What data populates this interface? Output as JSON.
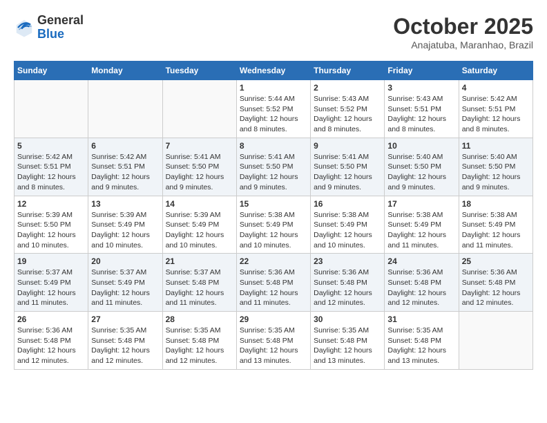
{
  "header": {
    "logo_line1": "General",
    "logo_line2": "Blue",
    "month": "October 2025",
    "location": "Anajatuba, Maranhao, Brazil"
  },
  "weekdays": [
    "Sunday",
    "Monday",
    "Tuesday",
    "Wednesday",
    "Thursday",
    "Friday",
    "Saturday"
  ],
  "weeks": [
    [
      {
        "day": "",
        "info": ""
      },
      {
        "day": "",
        "info": ""
      },
      {
        "day": "",
        "info": ""
      },
      {
        "day": "1",
        "info": "Sunrise: 5:44 AM\nSunset: 5:52 PM\nDaylight: 12 hours and 8 minutes."
      },
      {
        "day": "2",
        "info": "Sunrise: 5:43 AM\nSunset: 5:52 PM\nDaylight: 12 hours and 8 minutes."
      },
      {
        "day": "3",
        "info": "Sunrise: 5:43 AM\nSunset: 5:51 PM\nDaylight: 12 hours and 8 minutes."
      },
      {
        "day": "4",
        "info": "Sunrise: 5:42 AM\nSunset: 5:51 PM\nDaylight: 12 hours and 8 minutes."
      }
    ],
    [
      {
        "day": "5",
        "info": "Sunrise: 5:42 AM\nSunset: 5:51 PM\nDaylight: 12 hours and 8 minutes."
      },
      {
        "day": "6",
        "info": "Sunrise: 5:42 AM\nSunset: 5:51 PM\nDaylight: 12 hours and 9 minutes."
      },
      {
        "day": "7",
        "info": "Sunrise: 5:41 AM\nSunset: 5:50 PM\nDaylight: 12 hours and 9 minutes."
      },
      {
        "day": "8",
        "info": "Sunrise: 5:41 AM\nSunset: 5:50 PM\nDaylight: 12 hours and 9 minutes."
      },
      {
        "day": "9",
        "info": "Sunrise: 5:41 AM\nSunset: 5:50 PM\nDaylight: 12 hours and 9 minutes."
      },
      {
        "day": "10",
        "info": "Sunrise: 5:40 AM\nSunset: 5:50 PM\nDaylight: 12 hours and 9 minutes."
      },
      {
        "day": "11",
        "info": "Sunrise: 5:40 AM\nSunset: 5:50 PM\nDaylight: 12 hours and 9 minutes."
      }
    ],
    [
      {
        "day": "12",
        "info": "Sunrise: 5:39 AM\nSunset: 5:50 PM\nDaylight: 12 hours and 10 minutes."
      },
      {
        "day": "13",
        "info": "Sunrise: 5:39 AM\nSunset: 5:49 PM\nDaylight: 12 hours and 10 minutes."
      },
      {
        "day": "14",
        "info": "Sunrise: 5:39 AM\nSunset: 5:49 PM\nDaylight: 12 hours and 10 minutes."
      },
      {
        "day": "15",
        "info": "Sunrise: 5:38 AM\nSunset: 5:49 PM\nDaylight: 12 hours and 10 minutes."
      },
      {
        "day": "16",
        "info": "Sunrise: 5:38 AM\nSunset: 5:49 PM\nDaylight: 12 hours and 10 minutes."
      },
      {
        "day": "17",
        "info": "Sunrise: 5:38 AM\nSunset: 5:49 PM\nDaylight: 12 hours and 11 minutes."
      },
      {
        "day": "18",
        "info": "Sunrise: 5:38 AM\nSunset: 5:49 PM\nDaylight: 12 hours and 11 minutes."
      }
    ],
    [
      {
        "day": "19",
        "info": "Sunrise: 5:37 AM\nSunset: 5:49 PM\nDaylight: 12 hours and 11 minutes."
      },
      {
        "day": "20",
        "info": "Sunrise: 5:37 AM\nSunset: 5:49 PM\nDaylight: 12 hours and 11 minutes."
      },
      {
        "day": "21",
        "info": "Sunrise: 5:37 AM\nSunset: 5:48 PM\nDaylight: 12 hours and 11 minutes."
      },
      {
        "day": "22",
        "info": "Sunrise: 5:36 AM\nSunset: 5:48 PM\nDaylight: 12 hours and 11 minutes."
      },
      {
        "day": "23",
        "info": "Sunrise: 5:36 AM\nSunset: 5:48 PM\nDaylight: 12 hours and 12 minutes."
      },
      {
        "day": "24",
        "info": "Sunrise: 5:36 AM\nSunset: 5:48 PM\nDaylight: 12 hours and 12 minutes."
      },
      {
        "day": "25",
        "info": "Sunrise: 5:36 AM\nSunset: 5:48 PM\nDaylight: 12 hours and 12 minutes."
      }
    ],
    [
      {
        "day": "26",
        "info": "Sunrise: 5:36 AM\nSunset: 5:48 PM\nDaylight: 12 hours and 12 minutes."
      },
      {
        "day": "27",
        "info": "Sunrise: 5:35 AM\nSunset: 5:48 PM\nDaylight: 12 hours and 12 minutes."
      },
      {
        "day": "28",
        "info": "Sunrise: 5:35 AM\nSunset: 5:48 PM\nDaylight: 12 hours and 12 minutes."
      },
      {
        "day": "29",
        "info": "Sunrise: 5:35 AM\nSunset: 5:48 PM\nDaylight: 12 hours and 13 minutes."
      },
      {
        "day": "30",
        "info": "Sunrise: 5:35 AM\nSunset: 5:48 PM\nDaylight: 12 hours and 13 minutes."
      },
      {
        "day": "31",
        "info": "Sunrise: 5:35 AM\nSunset: 5:48 PM\nDaylight: 12 hours and 13 minutes."
      },
      {
        "day": "",
        "info": ""
      }
    ]
  ]
}
